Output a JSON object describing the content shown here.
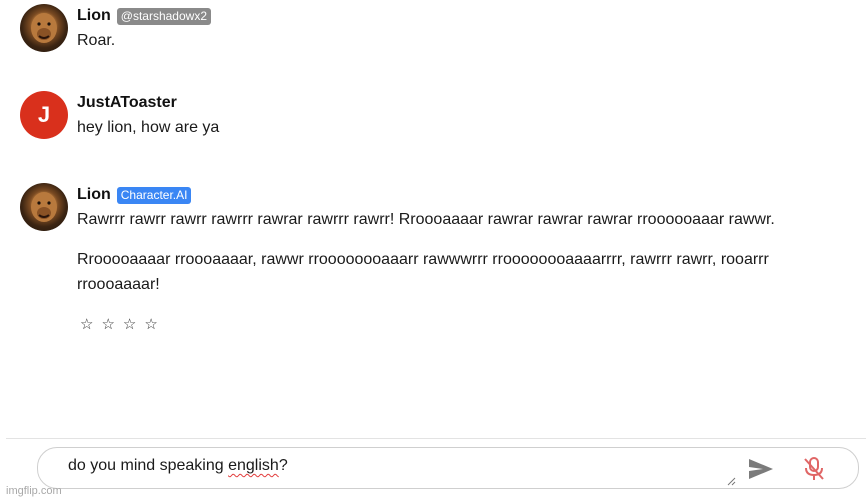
{
  "messages": [
    {
      "name": "Lion",
      "badge": "@starshadowx2",
      "paragraphs": [
        "Roar."
      ]
    },
    {
      "name": "JustAToaster",
      "avatar_letter": "J",
      "paragraphs": [
        "hey lion, how are ya"
      ]
    },
    {
      "name": "Lion",
      "badge": "Character.AI",
      "paragraphs": [
        "Rawrrr rawrr rawrr rawrrr rawrar rawrrr rawrr! Rroooaaaar rawrar rawrar rawrar rroooooaaar rawwr.",
        "Rrooooaaaar rroooaaaar, rawwr rroooooooaaarr rawwwrrr rroooooooaaaarrrr, rawrrr rawrr, rooarrr rroooaaaar!"
      ]
    }
  ],
  "rating": {
    "stars": [
      "☆",
      "☆",
      "☆",
      "☆"
    ]
  },
  "composer": {
    "text_before": "do you mind speaking ",
    "text_misspelled": "english",
    "text_after": "?"
  },
  "icons": {
    "send": "send-icon",
    "mic": "mic-off-icon"
  },
  "colors": {
    "user_avatar": "#d9301c",
    "badge_gray": "#8a8a8a",
    "badge_blue": "#3a86f4",
    "mic_off": "#e06666"
  },
  "watermark": "imgflip.com"
}
